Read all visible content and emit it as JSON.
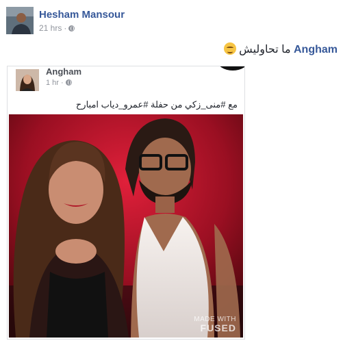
{
  "post": {
    "author": "Hesham Mansour",
    "time": "21 hrs",
    "privacy_icon": "globe-icon",
    "caption_link": "Angham",
    "caption_text": "ما تحاوليش",
    "emoji": "relieved-face-emoji"
  },
  "embedded_post": {
    "author": "Angham",
    "time": "1 hr",
    "privacy_icon": "globe-icon",
    "caption": "مع #منى_زكي من حفلة #عمرو_دياب امبارح"
  },
  "photo": {
    "watermark_small": "MADE WITH",
    "watermark_big": "FUSED"
  },
  "colors": {
    "link": "#365899",
    "meta": "#90949c",
    "background": "#ffffff"
  }
}
